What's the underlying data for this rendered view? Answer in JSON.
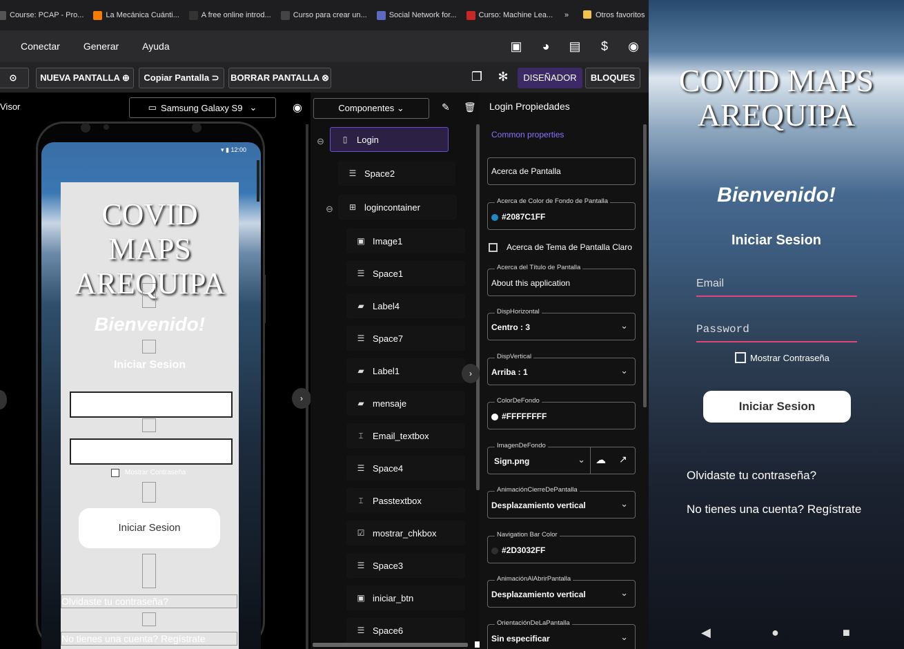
{
  "bookmarks": [
    {
      "label": "Course: PCAP - Pro...",
      "color": "#555555"
    },
    {
      "label": "La Mecánica Cuánti...",
      "color": "#f57c00"
    },
    {
      "label": "A free online introd...",
      "color": "#333333"
    },
    {
      "label": "Curso para crear un...",
      "color": "#444444"
    },
    {
      "label": "Social Network for...",
      "color": "#5c6bc0"
    },
    {
      "label": "Curso: Machine Lea...",
      "color": "#c62828"
    }
  ],
  "bookmarks_more": "»",
  "bookmarks_folder": "Otros favoritos",
  "menu": [
    "Conectar",
    "Generar",
    "Ayuda"
  ],
  "toolbar": {
    "nueva": "NUEVA PANTALLA ⊕",
    "copiar": "Copiar Pantalla ⊃",
    "borrar": "BORRAR PANTALLA ⊗",
    "disenador": "DISEÑADOR",
    "bloques": "BLOQUES"
  },
  "viewer": {
    "label": "Visor",
    "device": "Samsung Galaxy S9",
    "status_time": "12:00",
    "app_title_1": "COVID MAPS",
    "app_title_2": "AREQUIPA",
    "welcome": "Bienvenido!",
    "iniciar_label": "Iniciar Sesion",
    "show_password": "Mostrar Contraseña",
    "login_button": "Iniciar Sesion",
    "forgot": "Olvidaste tu contraseña?",
    "register": "No tienes una cuenta? Regístrate"
  },
  "components": {
    "header": "Componentes",
    "items": [
      {
        "label": "Login",
        "icon": "phone-icon"
      },
      {
        "label": "Space2",
        "icon": "space-icon"
      },
      {
        "label": "logincontainer",
        "icon": "container-icon"
      },
      {
        "label": "Image1",
        "icon": "image-icon"
      },
      {
        "label": "Space1",
        "icon": "space-icon"
      },
      {
        "label": "Label4",
        "icon": "label-icon"
      },
      {
        "label": "Space7",
        "icon": "space-icon"
      },
      {
        "label": "Label1",
        "icon": "label-icon"
      },
      {
        "label": "mensaje",
        "icon": "label-icon"
      },
      {
        "label": "Email_textbox",
        "icon": "textbox-icon"
      },
      {
        "label": "Space4",
        "icon": "space-icon"
      },
      {
        "label": "Passtextbox",
        "icon": "textbox-icon"
      },
      {
        "label": "mostrar_chkbox",
        "icon": "checkbox-icon"
      },
      {
        "label": "Space3",
        "icon": "space-icon"
      },
      {
        "label": "iniciar_btn",
        "icon": "button-icon"
      },
      {
        "label": "Space6",
        "icon": "space-icon"
      }
    ]
  },
  "properties": {
    "title": "Login Propiedades",
    "common": "Common properties",
    "about_screen": "Acerca de Pantalla",
    "bg_color_label": "Acerca de Color de Fondo de Pantalla",
    "bg_color_value": "#2087C1FF",
    "bg_color_hex": "#2087C1",
    "light_theme_label": "Acerca de Tema de Pantalla Claro",
    "about_title_label": "Acerca del Título de Pantalla",
    "about_title_value": "About this application",
    "disp_h_label": "DispHorizontal",
    "disp_h_value": "Centro : 3",
    "disp_v_label": "DispVertical",
    "disp_v_value": "Arriba : 1",
    "color_fondo_label": "ColorDeFondo",
    "color_fondo_value": "#FFFFFFFF",
    "imagen_label": "ImagenDeFondo",
    "imagen_value": "Sign.png",
    "anim_cierre_label": "AnimaciónCierreDePantalla",
    "anim_cierre_value": "Desplazamiento vertical",
    "nav_color_label": "Navigation Bar Color",
    "nav_color_value": "#2D3032FF",
    "nav_color_hex": "#2D3032",
    "anim_abrir_label": "AnimaciónAlAbrirPantalla",
    "anim_abrir_value": "Desplazamiento vertical",
    "orient_label": "OrientaciónDeLaPantalla",
    "orient_value": "Sin especificar"
  },
  "emulator": {
    "title_1": "COVID MAPS",
    "title_2": "AREQUIPA",
    "welcome": "Bienvenido!",
    "subtitle": "Iniciar Sesion",
    "email_placeholder": "Email",
    "password_placeholder": "Password",
    "show_password": "Mostrar Contraseña",
    "login_button": "Iniciar Sesion",
    "forgot": "Olvidaste tu contraseña?",
    "register": "No tienes una cuenta? Regístrate"
  }
}
